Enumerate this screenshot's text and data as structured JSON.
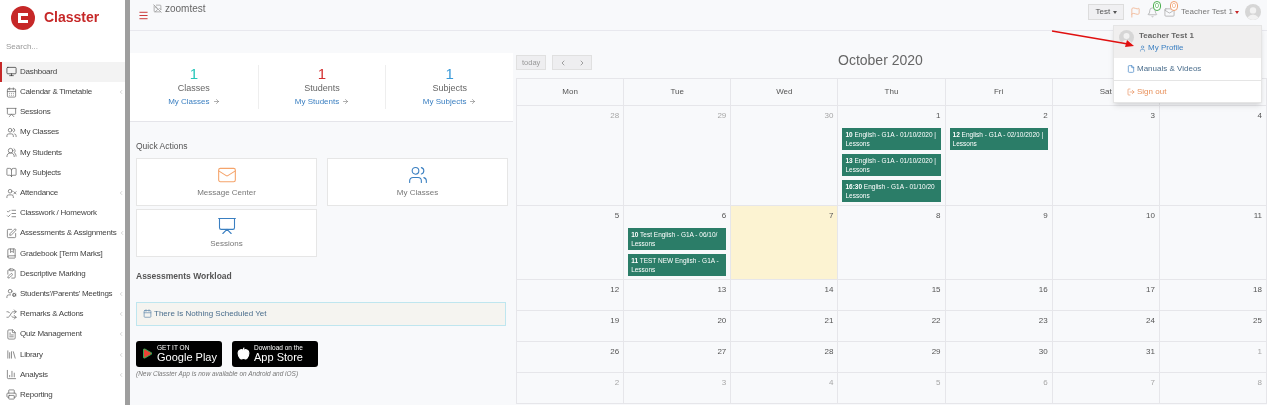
{
  "brand": {
    "name": "Classter"
  },
  "sidebar": {
    "search": {
      "placeholder": "Search..."
    },
    "items": [
      {
        "label": "Dashboard",
        "selected": true,
        "expandable": false
      },
      {
        "label": "Calendar & Timetable",
        "selected": false,
        "expandable": true
      },
      {
        "label": "Sessions",
        "selected": false,
        "expandable": false
      },
      {
        "label": "My Classes",
        "selected": false,
        "expandable": false
      },
      {
        "label": "My Students",
        "selected": false,
        "expandable": false
      },
      {
        "label": "My Subjects",
        "selected": false,
        "expandable": false
      },
      {
        "label": "Attendance",
        "selected": false,
        "expandable": true
      },
      {
        "label": "Classwork / Homework",
        "selected": false,
        "expandable": false
      },
      {
        "label": "Assessments & Assignments",
        "selected": false,
        "expandable": true
      },
      {
        "label": "Gradebook [Term Marks]",
        "selected": false,
        "expandable": false
      },
      {
        "label": "Descriptive Marking",
        "selected": false,
        "expandable": false
      },
      {
        "label": "Students'/Parents' Meetings",
        "selected": false,
        "expandable": true
      },
      {
        "label": "Remarks & Actions",
        "selected": false,
        "expandable": true
      },
      {
        "label": "Quiz Management",
        "selected": false,
        "expandable": true
      },
      {
        "label": "Library",
        "selected": false,
        "expandable": true
      },
      {
        "label": "Analysis",
        "selected": false,
        "expandable": true
      },
      {
        "label": "Reporting",
        "selected": false,
        "expandable": false
      }
    ]
  },
  "topbar": {
    "image_alt": "zoomtest",
    "school_button": "Test",
    "notifications": {
      "count": "0"
    },
    "messages": {
      "count": "0"
    },
    "user": "Teacher Test 1"
  },
  "user_menu": {
    "name": "Teacher Test 1",
    "profile_link": "My Profile",
    "items": [
      {
        "kind": "manuals",
        "label": "Manuals & Videos"
      },
      {
        "kind": "signout",
        "label": "Sign out"
      }
    ]
  },
  "stats": [
    {
      "value": "1",
      "label": "Classes",
      "link": "My Classes",
      "color": "#26c6b9"
    },
    {
      "value": "1",
      "label": "Students",
      "link": "My Students",
      "color": "#d32f2f"
    },
    {
      "value": "1",
      "label": "Subjects",
      "link": "My Subjects",
      "color": "#3a9ad9"
    }
  ],
  "quick_actions": {
    "title": "Quick Actions",
    "items": [
      {
        "kind": "message",
        "label": "Message Center"
      },
      {
        "kind": "classes",
        "label": "My Classes"
      },
      {
        "kind": "sessions",
        "label": "Sessions"
      }
    ]
  },
  "workload": {
    "title": "Assessments Workload",
    "message": "There Is Nothing Scheduled Yet"
  },
  "app_badges": [
    {
      "kind": "google",
      "small": "GET IT ON",
      "big": "Google Play"
    },
    {
      "kind": "apple",
      "small": "Download on the",
      "big": "App Store"
    }
  ],
  "app_note": "(New Classter App is now available on Android and iOS)",
  "calendar": {
    "today_button": "today",
    "title": "October 2020",
    "headers": [
      "Mon",
      "Tue",
      "Wed",
      "Thu",
      "Fri",
      "Sat"
    ],
    "weeks": [
      [
        {
          "day": "28",
          "other_month": true,
          "today": false
        },
        {
          "day": "29",
          "other_month": true,
          "today": false
        },
        {
          "day": "30",
          "other_month": true,
          "today": false
        },
        {
          "day": "1",
          "other_month": false,
          "today": false,
          "events": [
            {
              "time": "10",
              "title": "English - G1A - 01/10/2020 |",
              "type": "Lessons"
            },
            {
              "time": "13",
              "title": "English - G1A - 01/10/2020 |",
              "type": "Lessons"
            },
            {
              "time": "16:30",
              "title": "English - G1A - 01/10/20",
              "type": "Lessons"
            }
          ]
        },
        {
          "day": "2",
          "other_month": false,
          "today": false,
          "events": [
            {
              "time": "12",
              "title": "English - G1A - 02/10/2020 |",
              "type": "Lessons"
            }
          ]
        },
        {
          "day": "3",
          "other_month": false,
          "today": false
        },
        {
          "day": "4",
          "other_month": false,
          "today": false
        }
      ],
      [
        {
          "day": "5",
          "other_month": false,
          "today": false
        },
        {
          "day": "6",
          "other_month": false,
          "today": false,
          "events": [
            {
              "time": "10",
              "title": "Test English - G1A - 06/10/",
              "type": "Lessons"
            },
            {
              "time": "11",
              "title": "TEST NEW English - G1A -",
              "type": "Lessons"
            }
          ]
        },
        {
          "day": "7",
          "other_month": false,
          "today": true
        },
        {
          "day": "8",
          "other_month": false,
          "today": false
        },
        {
          "day": "9",
          "other_month": false,
          "today": false
        },
        {
          "day": "10",
          "other_month": false,
          "today": false
        },
        {
          "day": "11",
          "other_month": false,
          "today": false
        }
      ],
      [
        {
          "day": "12",
          "other_month": false,
          "today": false
        },
        {
          "day": "13",
          "other_month": false,
          "today": false
        },
        {
          "day": "14",
          "other_month": false,
          "today": false
        },
        {
          "day": "15",
          "other_month": false,
          "today": false
        },
        {
          "day": "16",
          "other_month": false,
          "today": false
        },
        {
          "day": "17",
          "other_month": false,
          "today": false
        },
        {
          "day": "18",
          "other_month": false,
          "today": false
        }
      ],
      [
        {
          "day": "19",
          "other_month": false,
          "today": false
        },
        {
          "day": "20",
          "other_month": false,
          "today": false
        },
        {
          "day": "21",
          "other_month": false,
          "today": false
        },
        {
          "day": "22",
          "other_month": false,
          "today": false
        },
        {
          "day": "23",
          "other_month": false,
          "today": false
        },
        {
          "day": "24",
          "other_month": false,
          "today": false
        },
        {
          "day": "25",
          "other_month": false,
          "today": false
        }
      ],
      [
        {
          "day": "26",
          "other_month": false,
          "today": false
        },
        {
          "day": "27",
          "other_month": false,
          "today": false
        },
        {
          "day": "28",
          "other_month": false,
          "today": false
        },
        {
          "day": "29",
          "other_month": false,
          "today": false
        },
        {
          "day": "30",
          "other_month": false,
          "today": false
        },
        {
          "day": "31",
          "other_month": false,
          "today": false
        },
        {
          "day": "1",
          "other_month": true,
          "today": false
        }
      ],
      [
        {
          "day": "2",
          "other_month": true,
          "today": false
        },
        {
          "day": "3",
          "other_month": true,
          "today": false
        },
        {
          "day": "4",
          "other_month": true,
          "today": false
        },
        {
          "day": "5",
          "other_month": true,
          "today": false
        },
        {
          "day": "6",
          "other_month": true,
          "today": false
        },
        {
          "day": "7",
          "other_month": true,
          "today": false
        },
        {
          "day": "8",
          "other_month": true,
          "today": false
        }
      ]
    ]
  }
}
